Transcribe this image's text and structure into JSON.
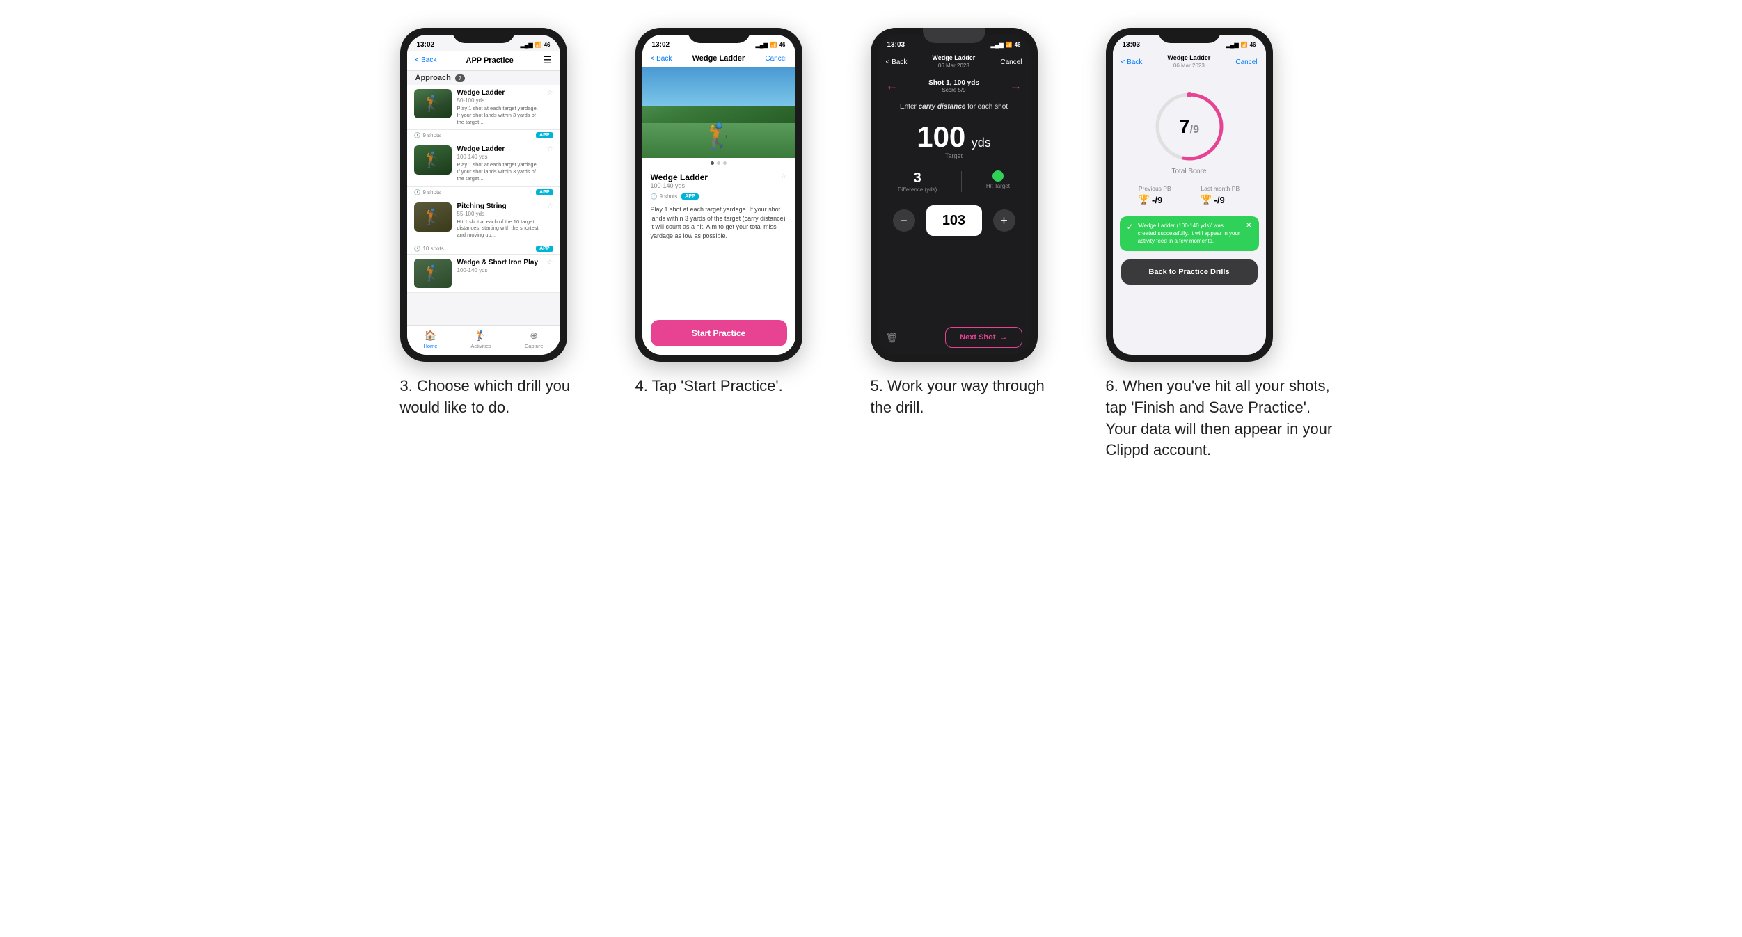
{
  "phones": [
    {
      "id": "phone1",
      "status_time": "13:02",
      "nav": {
        "back_label": "< Back",
        "title": "APP Practice",
        "action": "☰"
      },
      "section": {
        "label": "Approach",
        "badge": "7"
      },
      "drills": [
        {
          "title": "Wedge Ladder",
          "yardage": "50-100 yds",
          "desc": "Play 1 shot at each target yardage. If your shot lands within 3 yards of the target...",
          "shots": "9 shots",
          "badge": "APP"
        },
        {
          "title": "Wedge Ladder",
          "yardage": "100-140 yds",
          "desc": "Play 1 shot at each target yardage. If your shot lands within 3 yards of the target...",
          "shots": "9 shots",
          "badge": "APP"
        },
        {
          "title": "Pitching String",
          "yardage": "55-100 yds",
          "desc": "Hit 1 shot at each of the 10 target distances, starting with the shortest and moving up...",
          "shots": "10 shots",
          "badge": "APP"
        },
        {
          "title": "Wedge & Short Iron Play",
          "yardage": "100-140 yds",
          "desc": "",
          "shots": "",
          "badge": ""
        }
      ],
      "tabs": [
        {
          "label": "Home",
          "icon": "🏠",
          "active": true
        },
        {
          "label": "Activities",
          "icon": "🏌️",
          "active": false
        },
        {
          "label": "Capture",
          "icon": "➕",
          "active": false
        }
      ],
      "caption": "3. Choose which drill you would like to do."
    },
    {
      "id": "phone2",
      "status_time": "13:02",
      "nav": {
        "back_label": "< Back",
        "title": "Wedge Ladder",
        "action": "Cancel"
      },
      "detail": {
        "title": "Wedge Ladder",
        "yardage": "100-140 yds",
        "shots": "9 shots",
        "badge": "APP",
        "desc": "Play 1 shot at each target yardage. If your shot lands within 3 yards of the target (carry distance) it will count as a hit. Aim to get your total miss yardage as low as possible."
      },
      "start_btn": "Start Practice",
      "caption": "4. Tap 'Start Practice'."
    },
    {
      "id": "phone3",
      "status_time": "13:03",
      "nav": {
        "back_label": "< Back",
        "title_line1": "Wedge Ladder",
        "title_line2": "06 Mar 2023",
        "action": "Cancel"
      },
      "shot": {
        "shot_label": "Shot 1, 100 yds",
        "score_label": "Score 5/9",
        "enter_label": "Enter carry distance for each shot",
        "target_value": "100",
        "target_unit": "yds",
        "target_sub": "Target",
        "diff_value": "3",
        "diff_label": "Difference (yds)",
        "hit_label": "Hit Target",
        "input_value": "103"
      },
      "next_shot_btn": "Next Shot",
      "caption": "5. Work your way through the drill."
    },
    {
      "id": "phone4",
      "status_time": "13:03",
      "nav": {
        "back_label": "< Back",
        "title_line1": "Wedge Ladder",
        "title_line2": "06 Mar 2023",
        "action": "Cancel"
      },
      "results": {
        "score": "7",
        "denom": "/9",
        "total_label": "Total Score",
        "prev_pb_label": "Previous PB",
        "prev_pb_value": "-/9",
        "last_month_label": "Last month PB",
        "last_month_value": "-/9"
      },
      "toast": {
        "text": "'Wedge Ladder (100-140 yds)' was created successfully. It will appear in your activity feed in a few moments."
      },
      "back_btn": "Back to Practice Drills",
      "caption": "6. When you've hit all your shots, tap 'Finish and Save Practice'. Your data will then appear in your Clippd account."
    }
  ]
}
